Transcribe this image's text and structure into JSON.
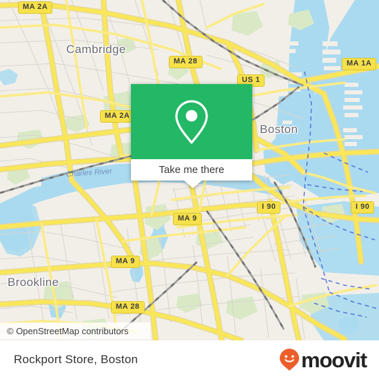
{
  "map": {
    "attribution": "© OpenStreetMap contributors",
    "base_color": "#f2efe9",
    "water_color": "#aadaf0",
    "road_color": "#f7e14a",
    "park_color": "#d6e8c4",
    "place_labels": [
      {
        "name": "Cambridge",
        "text": "Cambridge"
      },
      {
        "name": "Boston",
        "text": "Boston"
      },
      {
        "name": "Brookline",
        "text": "Brookline"
      }
    ],
    "water_labels": [
      {
        "name": "Charles River",
        "text": "Charles River"
      }
    ],
    "shields": [
      {
        "id": "ma2a-top",
        "label": "MA 2A"
      },
      {
        "id": "ma28-top",
        "label": "MA 28"
      },
      {
        "id": "us1",
        "label": "US 1"
      },
      {
        "id": "ma1a",
        "label": "MA 1A"
      },
      {
        "id": "ma2a-mid",
        "label": "MA 2A"
      },
      {
        "id": "i90-left",
        "label": "I 90"
      },
      {
        "id": "i90-right",
        "label": "I 90"
      },
      {
        "id": "ma9-upper",
        "label": "MA 9"
      },
      {
        "id": "ma9-lower",
        "label": "MA 9"
      },
      {
        "id": "ma28-bottom",
        "label": "MA 28"
      }
    ]
  },
  "popup": {
    "accent_color": "#22b865",
    "icon": "map-pin-icon",
    "action_label": "Take me there"
  },
  "footer": {
    "title": "Rockport Store, Boston",
    "brand_name": "moovit",
    "brand_color": "#ec5f2a"
  }
}
